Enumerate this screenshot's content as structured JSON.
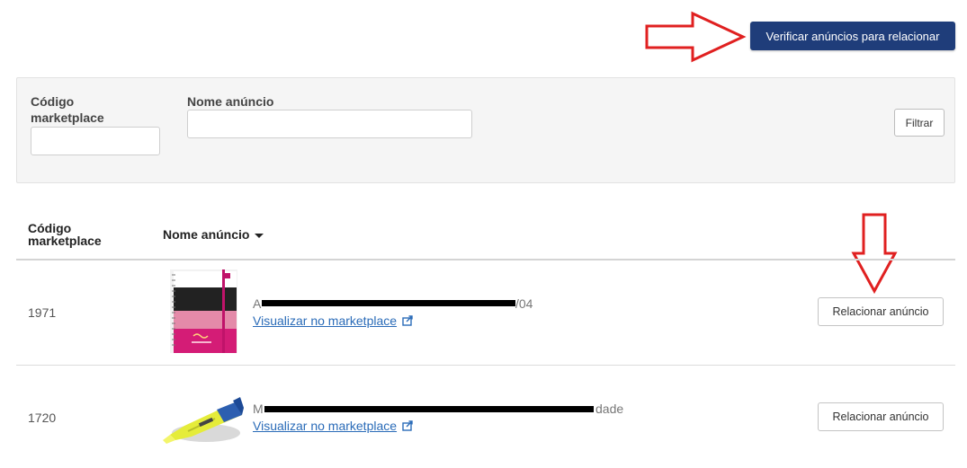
{
  "toolbar": {
    "verify_label": "Verificar anúncios para relacionar"
  },
  "filters": {
    "code_label": "Código marketplace",
    "code_value": "",
    "name_label": "Nome anúncio",
    "name_value": "",
    "filter_button": "Filtrar"
  },
  "table": {
    "headers": {
      "code": "Código marketplace",
      "name": "Nome anúncio"
    },
    "rows": [
      {
        "code": "1971",
        "title_start": "A",
        "title_end": "/04",
        "link": "Visualizar no marketplace",
        "action": "Relacionar anúncio"
      },
      {
        "code": "1720",
        "title_start": "M",
        "title_end": "dade",
        "link": "Visualizar no marketplace",
        "action": "Relacionar anúncio"
      }
    ]
  },
  "colors": {
    "primary": "#1f3d7a",
    "annotation_arrow": "#e02020",
    "link": "#2a6bb8"
  },
  "icons": [
    "right-arrow-annotation-icon",
    "down-arrow-annotation-icon",
    "external-link-icon",
    "sort-caret-icon"
  ]
}
